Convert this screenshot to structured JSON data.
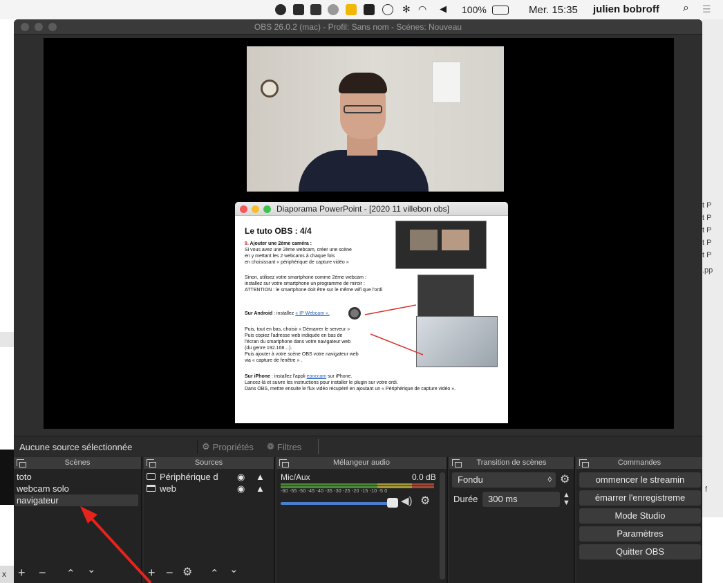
{
  "menubar": {
    "battery": "100%",
    "clock": "Mer. 15:35",
    "user": "julien bobroff"
  },
  "window": {
    "title": "OBS 26.0.2 (mac) - Profil: Sans nom - Scènes: Nouveau"
  },
  "background": {
    "right_rows": [
      "t P",
      "t P",
      "t P",
      "t P",
      "t P",
      ".pp"
    ],
    "right_f": "f",
    "bottom_left": "x"
  },
  "ppt": {
    "title": "Diaporama PowerPoint - [2020 11 villebon obs]",
    "slide": {
      "heading": "Le tuto OBS : 4/4",
      "step_num": "9.",
      "step_title": "Ajouter une 2ème caméra :",
      "p1_l1": "Si vous avez une 2ème webcam, créer une scène",
      "p1_l2": "en y mettant les 2 webcams à chaque fois",
      "p1_l3": "en choisissant « périphérique de capture vidéo »",
      "p2_l1": "Sinon, utilisez votre smartphone comme 2ème webcam :",
      "p2_l2": "installez sur votre smartphone un programme de miroir :",
      "p2_l3": "ATTENTION : le smartphone doit être sur le même wifi que l'ordi",
      "android_label": "Sur Android",
      "android_text": " : installez ",
      "android_link": "« IP Webcam ».",
      "p3_l1": "Puis, tout en bas, choisir  « Démarrer le serveur »",
      "p3_l2": "Puis copiez l'adresse web indiquée en bas de",
      "p3_l3": "l'écran du smartphone dans votre navigateur web",
      "p3_l4": "(du genre 192.168…).",
      "p3_l5": "Puis ajouter à votre scène OBS votre navigateur web",
      "p3_l6": "via « capture de fenêtre » .",
      "iphone_label": "Sur iPhone",
      "iphone_text": " : installez l'appli ",
      "iphone_link": "epoccam",
      "iphone_text2": " sur iPhone.",
      "p4_l2": "Lancez-là et suivre les instructions pour installer le plugin sur votre ordi.",
      "p4_l3": "Dans OBS, mettre ensuite le flux vidéo récupéré en ajoutant un « Périphérique de capture vidéo »."
    }
  },
  "status": {
    "no_source": "Aucune source sélectionnée",
    "properties": "Propriétés",
    "filters": "Filtres"
  },
  "scenes": {
    "header": "Scènes",
    "items": [
      "toto",
      "webcam solo",
      "navigateur"
    ]
  },
  "sources": {
    "header": "Sources",
    "items": [
      "Périphérique d",
      "web"
    ]
  },
  "mixer": {
    "header": "Mélangeur audio",
    "channel": "Mic/Aux",
    "level": "0.0 dB",
    "ticks": "-60  -55  -50  -45  -40  -35  -30  -25  -20  -15  -10   -5    0"
  },
  "transitions": {
    "header": "Transition de scènes",
    "selected": "Fondu",
    "duration_label": "Durée",
    "duration_value": "300 ms"
  },
  "controls": {
    "header": "Commandes",
    "buttons": [
      "ommencer le streamin",
      "émarrer l'enregistreme",
      "Mode Studio",
      "Paramètres",
      "Quitter OBS"
    ]
  },
  "colors": {
    "obs_bg": "#2a2a2a",
    "dock_bg": "#232323",
    "button_bg": "#3b3b3b",
    "annotation_arrow": "#e8231b",
    "fader_blue": "#4a7fd0"
  }
}
